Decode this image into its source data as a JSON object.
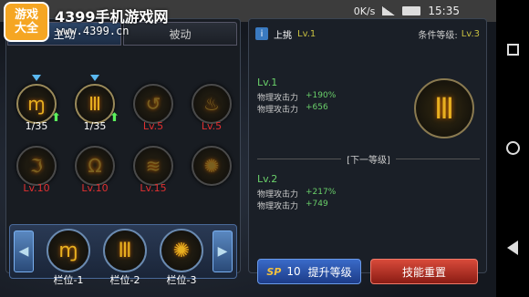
{
  "statusbar": {
    "net_speed": "0K/s",
    "time": "15:35"
  },
  "watermark": {
    "badge_line1": "游戏",
    "badge_line2": "大全",
    "title": "4399手机游戏网",
    "url": "www.4399.cn"
  },
  "tabs": [
    {
      "label": "主动",
      "active": true
    },
    {
      "label": "被动",
      "active": false
    }
  ],
  "skills": [
    {
      "icon": "claw-slash-icon",
      "glyph": "ɱ",
      "label": "1/35",
      "label_color": "white",
      "learned": true,
      "marker": true,
      "upgrade": true
    },
    {
      "icon": "comb-claw-icon",
      "glyph": "Ⅲ",
      "label": "1/35",
      "label_color": "white",
      "learned": true,
      "marker": true,
      "upgrade": true
    },
    {
      "icon": "spiral-icon",
      "glyph": "↺",
      "label": "Lv.5",
      "label_color": "red",
      "learned": false
    },
    {
      "icon": "flame-icon",
      "glyph": "♨",
      "label": "Lv.5",
      "label_color": "red",
      "learned": false
    },
    {
      "icon": "hook-icon",
      "glyph": "ℑ",
      "label": "Lv.10",
      "label_color": "red",
      "learned": false
    },
    {
      "icon": "totem-icon",
      "glyph": "Ω",
      "label": "Lv.10",
      "label_color": "red",
      "learned": false
    },
    {
      "icon": "wave-icon",
      "glyph": "≋",
      "label": "Lv.15",
      "label_color": "red",
      "learned": false
    },
    {
      "icon": "shuriken-icon",
      "glyph": "✺",
      "label": "",
      "label_color": "red",
      "learned": false
    }
  ],
  "slots": [
    {
      "icon": "claw-slash-icon",
      "glyph": "ɱ",
      "label": "栏位-1"
    },
    {
      "icon": "comb-claw-icon",
      "glyph": "Ⅲ",
      "label": "栏位-2"
    },
    {
      "icon": "shuriken-icon",
      "glyph": "✺",
      "label": "栏位-3"
    }
  ],
  "detail": {
    "name": "上挑",
    "level": "Lv.1",
    "req_label": "条件等级:",
    "req_value": "Lv.3",
    "current": {
      "title": "Lv.1",
      "stats": [
        {
          "name": "物理攻击力",
          "value": "+190%"
        },
        {
          "name": "物理攻击力",
          "value": "+656"
        }
      ]
    },
    "next_label": "[下一等级]",
    "next": {
      "title": "Lv.2",
      "stats": [
        {
          "name": "物理攻击力",
          "value": "+217%"
        },
        {
          "name": "物理攻击力",
          "value": "+749"
        }
      ]
    },
    "icon": "comb-claw-icon",
    "glyph": "Ⅲ"
  },
  "buttons": {
    "sp_label": "SP",
    "sp_value": "10",
    "upgrade_label": "提升等级",
    "reset_label": "技能重置"
  },
  "colors": {
    "accent_green": "#6ad06a",
    "accent_gold": "#e8b020",
    "reset_red": "#d84a3a",
    "upgrade_blue": "#3a6ac8"
  }
}
